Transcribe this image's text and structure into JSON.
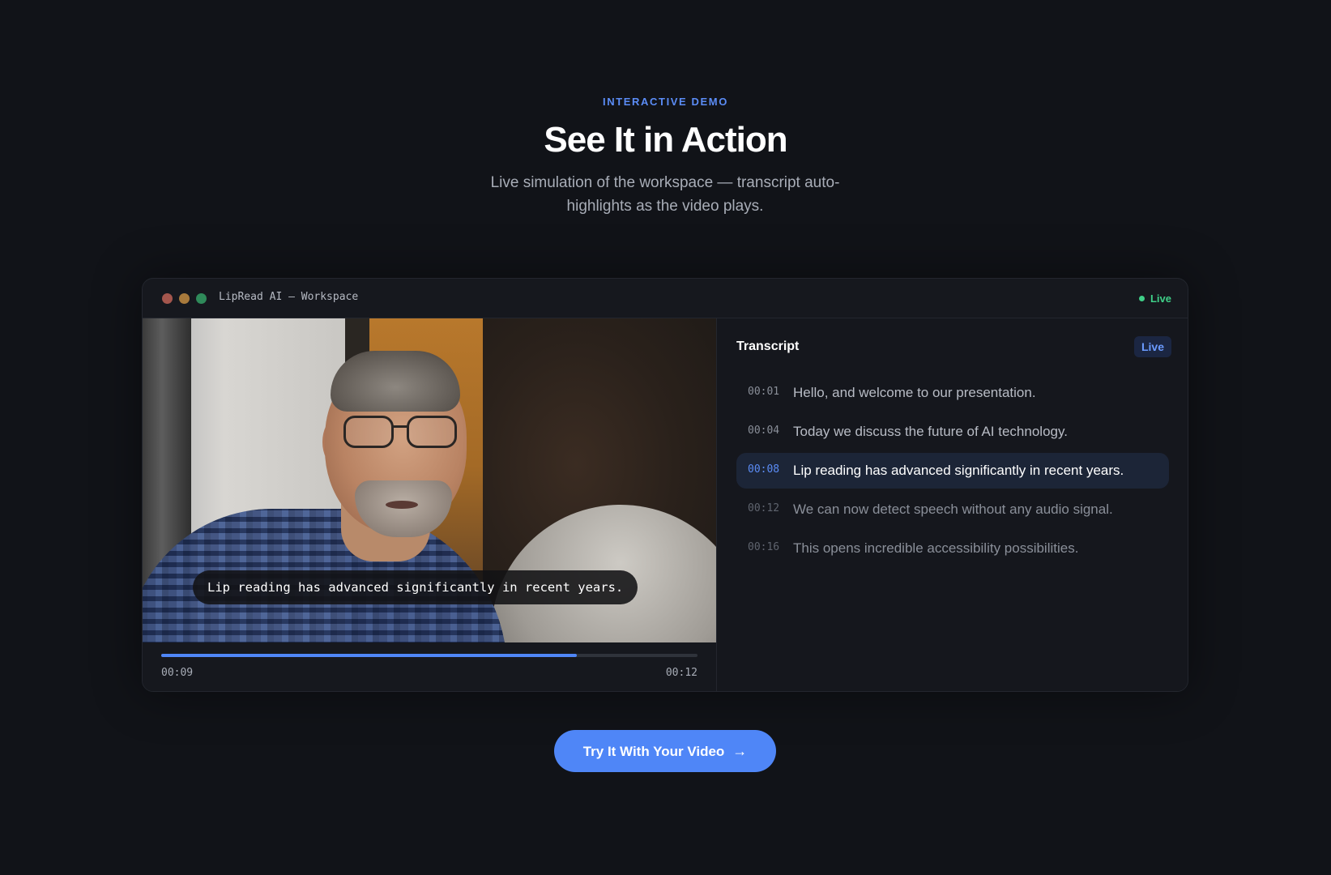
{
  "section": {
    "eyebrow": "INTERACTIVE DEMO",
    "title": "See It in Action",
    "subtitle": "Live simulation of the workspace — transcript auto-highlights as the video plays."
  },
  "window": {
    "title": "LipRead AI — Workspace",
    "status": "Live",
    "status_color": "#3fcf88"
  },
  "video": {
    "caption": "Lip reading has advanced significantly in recent years.",
    "current_time": "00:09",
    "duration": "00:12",
    "progress": 0.775
  },
  "transcript": {
    "title": "Transcript",
    "badge": "Live",
    "lines": [
      {
        "time": "00:01",
        "text": "Hello, and welcome to our presentation.",
        "state": "past"
      },
      {
        "time": "00:04",
        "text": "Today we discuss the future of AI technology.",
        "state": "past"
      },
      {
        "time": "00:08",
        "text": "Lip reading has advanced significantly in recent years.",
        "state": "active"
      },
      {
        "time": "00:12",
        "text": "We can now detect speech without any audio signal.",
        "state": "upcoming"
      },
      {
        "time": "00:16",
        "text": "This opens incredible accessibility possibilities.",
        "state": "upcoming"
      }
    ]
  },
  "cta": {
    "label": "Try It With Your Video",
    "icon": "arrow-right-icon",
    "color": "#4f86f7"
  }
}
